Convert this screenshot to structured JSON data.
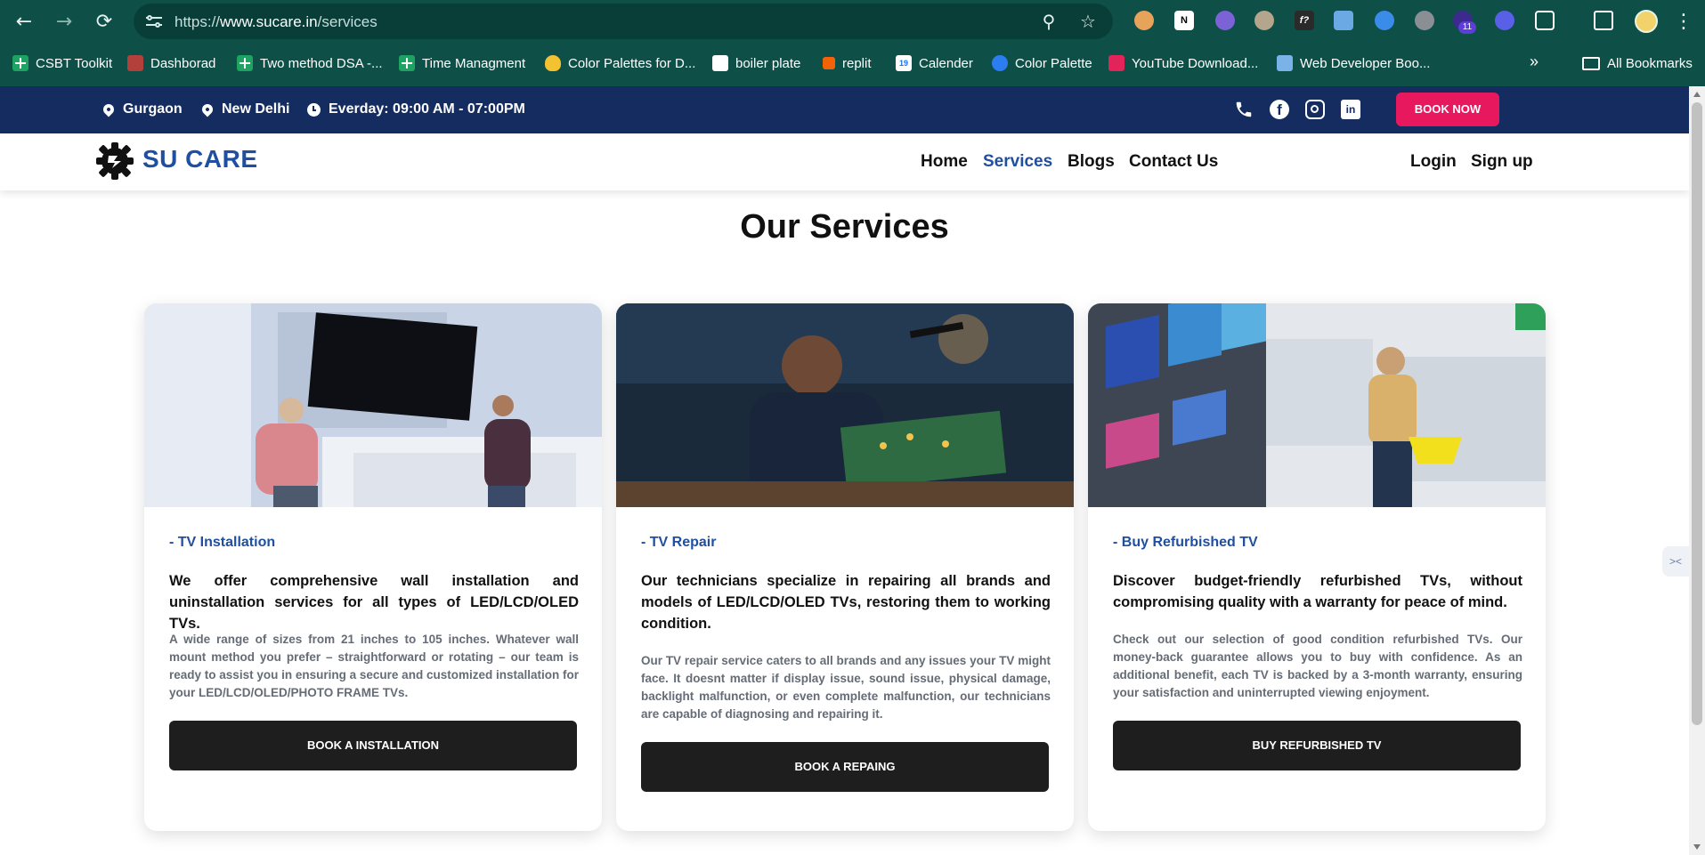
{
  "browser": {
    "url_prefix": "https://",
    "url_host": "www.sucare.in",
    "url_path": "/services",
    "extension_badge": "11",
    "bookmarks": [
      {
        "label": "CSBT Toolkit",
        "icon": "sheets-icon"
      },
      {
        "label": "Dashborad",
        "icon": "app-icon"
      },
      {
        "label": "Two method DSA -...",
        "icon": "sheets-icon"
      },
      {
        "label": "Time Managment",
        "icon": "sheets-icon"
      },
      {
        "label": "Color Palettes for D...",
        "icon": "palette-icon"
      },
      {
        "label": "boiler plate",
        "icon": "notion-icon"
      },
      {
        "label": "replit",
        "icon": "replit-icon"
      },
      {
        "label": "Calender",
        "icon": "calendar-icon"
      },
      {
        "label": "Color Palette",
        "icon": "color-icon"
      },
      {
        "label": "YouTube Download...",
        "icon": "download-icon"
      },
      {
        "label": "Web Developer Boo...",
        "icon": "laptop-icon"
      }
    ],
    "all_bookmarks": "All Bookmarks",
    "calendar_day": "19",
    "notion_letter": "N",
    "fx_letter": "f?"
  },
  "topbar": {
    "location_1": "Gurgaon",
    "location_2": "New Delhi",
    "hours": "Everday: 09:00 AM - 07:00PM",
    "book_now": "BOOK NOW",
    "facebook_letter": "f",
    "linkedin_letter": "in"
  },
  "header": {
    "brand": "SU CARE",
    "nav": [
      "Home",
      "Services",
      "Blogs",
      "Contact Us"
    ],
    "active_nav": "Services",
    "login": "Login",
    "signup": "Sign up"
  },
  "main": {
    "title": "Our Services",
    "cards": [
      {
        "tag": "- TV Installation",
        "headline": "We offer comprehensive wall installation and uninstallation services for all types of LED/LCD/OLED TVs.",
        "body": "A wide range of sizes from 21 inches to 105 inches. Whatever wall mount method you prefer – straightforward or rotating – our team is ready to assist you in ensuring a secure and customized installation for your LED/LCD/OLED/PHOTO FRAME TVs.",
        "button": "BOOK A INSTALLATION"
      },
      {
        "tag": "- TV Repair",
        "headline": "Our technicians specialize in repairing all brands and models of LED/LCD/OLED TVs, restoring them to working condition.",
        "body": "Our TV repair service caters to all brands and any issues your TV might face. It doesnt matter if display issue, sound issue, physical damage, backlight malfunction, or even complete malfunction, our technicians are capable of diagnosing and repairing it.",
        "button": "BOOK A REPAING"
      },
      {
        "tag": "- Buy Refurbished TV",
        "headline": "Discover budget-friendly refurbished TVs, without compromising quality with a warranty for peace of mind.",
        "body": "Check out our selection of good condition refurbished TVs. Our money-back guarantee allows you to buy with confidence. As an additional benefit, each TV is backed by a 3-month warranty, ensuring your satisfaction and uninterrupted viewing enjoyment.",
        "button": "BUY REFURBISHED TV"
      }
    ]
  },
  "colors": {
    "chrome": "#0e5048",
    "topbar": "#142c60",
    "brand_blue": "#1f4fa0",
    "book_now": "#e8185e",
    "card_button": "#1e1e1e"
  }
}
